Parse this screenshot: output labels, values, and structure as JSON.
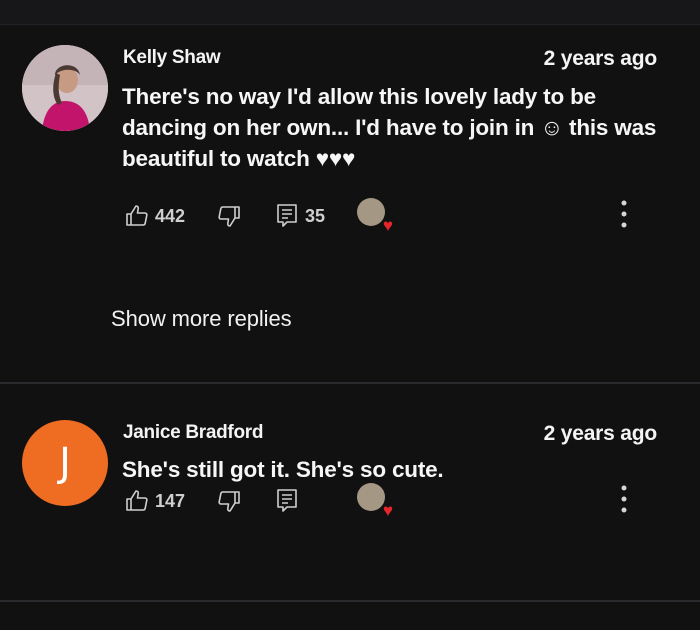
{
  "comments": [
    {
      "author": "Kelly Shaw",
      "time": "2 years ago",
      "text": "There's no way I'd allow this lovely lady to be dancing on her own... I'd have to join in ☺ this was beautiful to watch ♥♥♥",
      "likes": "442",
      "replies": "35",
      "avatar_icon": "profile-photo",
      "creator_heart": true
    },
    {
      "author": "Janice Bradford",
      "time": "2 years ago",
      "text": "She's still got it.  She's so cute.",
      "likes": "147",
      "replies": "",
      "avatar_letter": "J",
      "avatar_color": "#ef6c23",
      "creator_heart": true
    }
  ],
  "show_more_replies": "Show more replies",
  "icons": {
    "like": "thumbs-up-icon",
    "dislike": "thumbs-down-icon",
    "reply": "comment-icon",
    "more": "more-vertical-icon",
    "heart": "heart-icon"
  },
  "colors": {
    "background": "#111112",
    "heart": "#e8252a",
    "avatar_orange": "#ef6c23"
  }
}
